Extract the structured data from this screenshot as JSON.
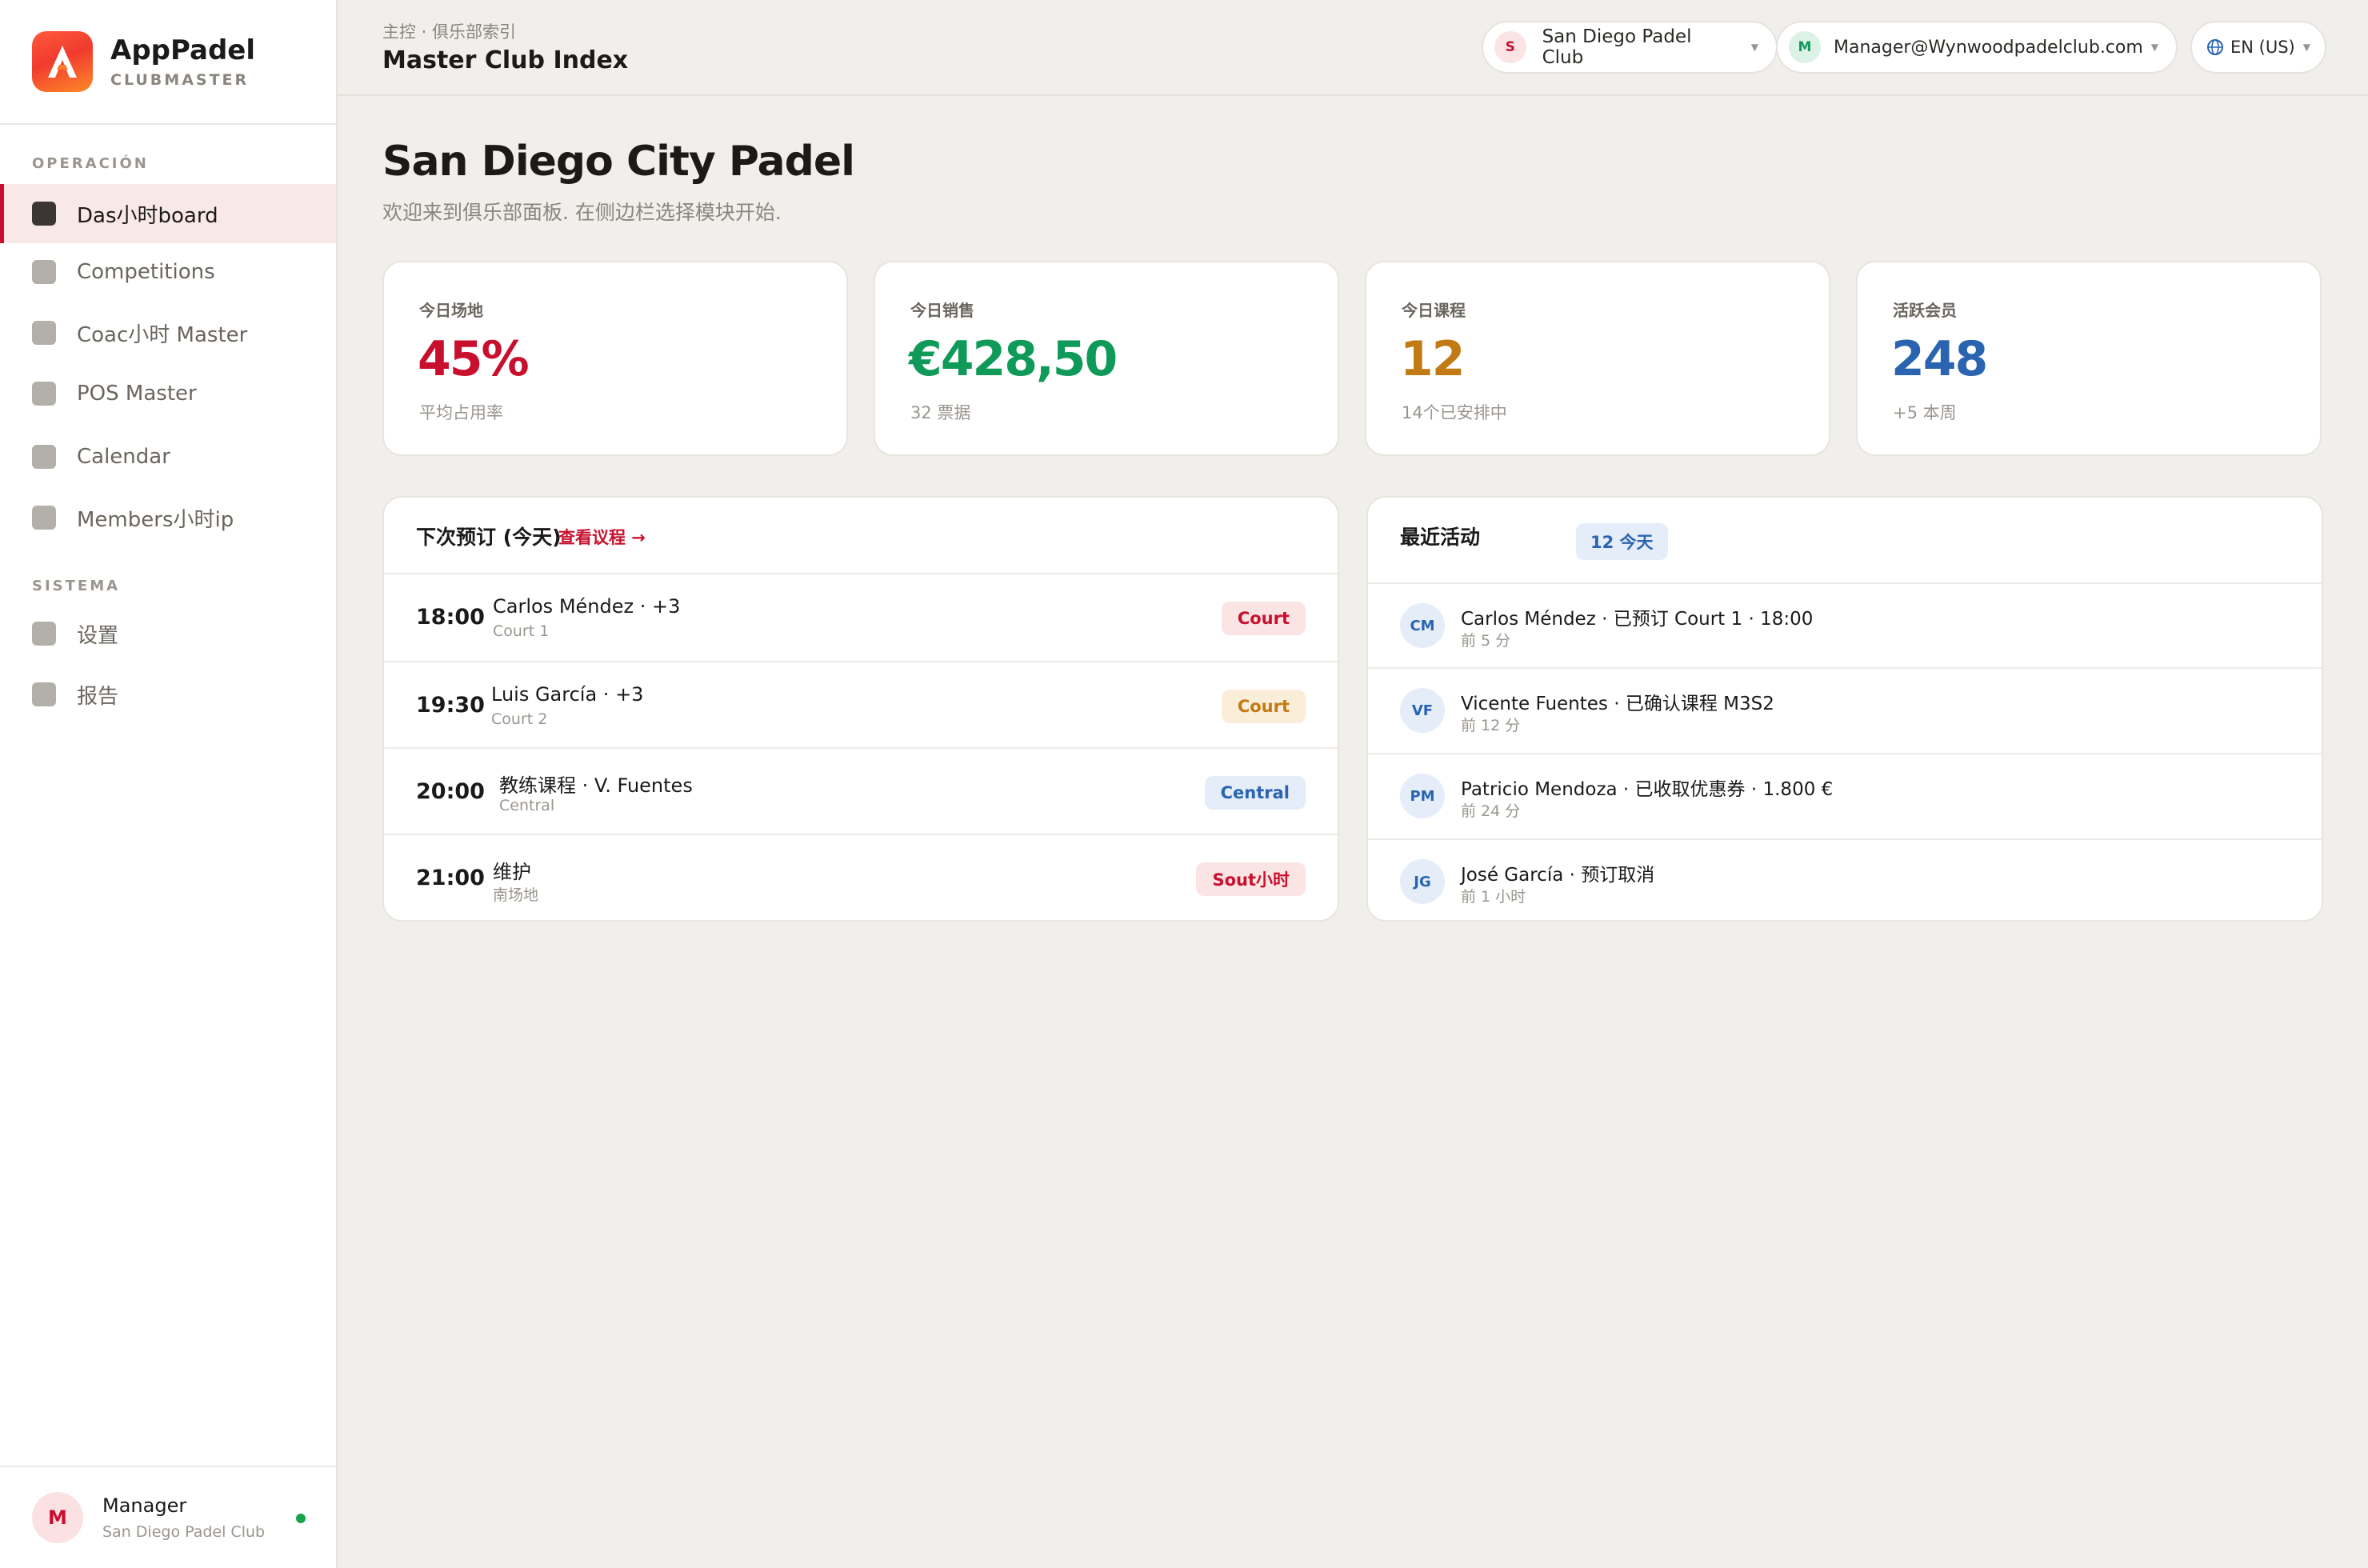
{
  "brand": {
    "name": "AppPadel",
    "sub": "CLUBMASTER"
  },
  "sidebar": {
    "sections": {
      "operacion": "OPERACIÓN",
      "sistema": "SISTEMA"
    },
    "items": [
      {
        "label": "Das小时board"
      },
      {
        "label": "Competitions"
      },
      {
        "label": "Coac小时 Master"
      },
      {
        "label": "POS Master"
      },
      {
        "label": "Calendar"
      },
      {
        "label": "Members小时ip"
      },
      {
        "label": "设置"
      },
      {
        "label": "报告"
      }
    ],
    "footer": {
      "avatar": "M",
      "name": "Manager",
      "club": "San Diego Padel Club"
    }
  },
  "topbar": {
    "breadcrumb": "主控 · 俱乐部索引",
    "title": "Master Club Index",
    "club_selector": {
      "avatar": "S",
      "label": "San Diego Padel Club"
    },
    "user_selector": {
      "avatar": "M",
      "label": "Manager@Wynwoodpadelclub.com"
    },
    "language": {
      "label": "EN (US)"
    }
  },
  "hero": {
    "title": "San Diego City Padel",
    "subtitle": "欢迎来到俱乐部面板. 在侧边栏选择模块开始."
  },
  "stats": [
    {
      "label": "今日场地",
      "value": "45%",
      "note": "平均占用率",
      "color": "#c8102e"
    },
    {
      "label": "今日销售",
      "value": "€428,50",
      "note": "32 票据",
      "color": "#0f9a5a"
    },
    {
      "label": "今日课程",
      "value": "12",
      "note": "14个已安排中",
      "color": "#c27a14"
    },
    {
      "label": "活跃会员",
      "value": "248",
      "note": "+5 本周",
      "color": "#2a64b0"
    }
  ],
  "bookings": {
    "title": "下次预订 (今天)",
    "link": "查看议程 →",
    "rows": [
      {
        "time": "18:00",
        "name": "Carlos Méndez · +3",
        "place": "Court 1",
        "tag": "Court"
      },
      {
        "time": "19:30",
        "name": "Luis García · +3",
        "place": "Court 2",
        "tag": "Court"
      },
      {
        "time": "20:00",
        "name": "教练课程 · V. Fuentes",
        "place": "Central",
        "tag": "Central"
      },
      {
        "time": "21:00",
        "name": "维护",
        "place": "南场地",
        "tag": "Sout小时"
      }
    ]
  },
  "activity": {
    "title": "最近活动",
    "badge": "12 今天",
    "rows": [
      {
        "initials": "CM",
        "text": "Carlos Méndez · 已预订 Court 1 · 18:00",
        "time": "前 5 分"
      },
      {
        "initials": "VF",
        "text": "Vicente Fuentes · 已确认课程 M3S2",
        "time": "前 12 分"
      },
      {
        "initials": "PM",
        "text": "Patricio Mendoza · 已收取优惠券 · 1.800 €",
        "time": "前 24 分"
      },
      {
        "initials": "JG",
        "text": "José García · 预订取消",
        "time": "前 1 小时"
      }
    ]
  },
  "colors": {
    "accent": "#c8102e",
    "online": "#16a34a"
  }
}
